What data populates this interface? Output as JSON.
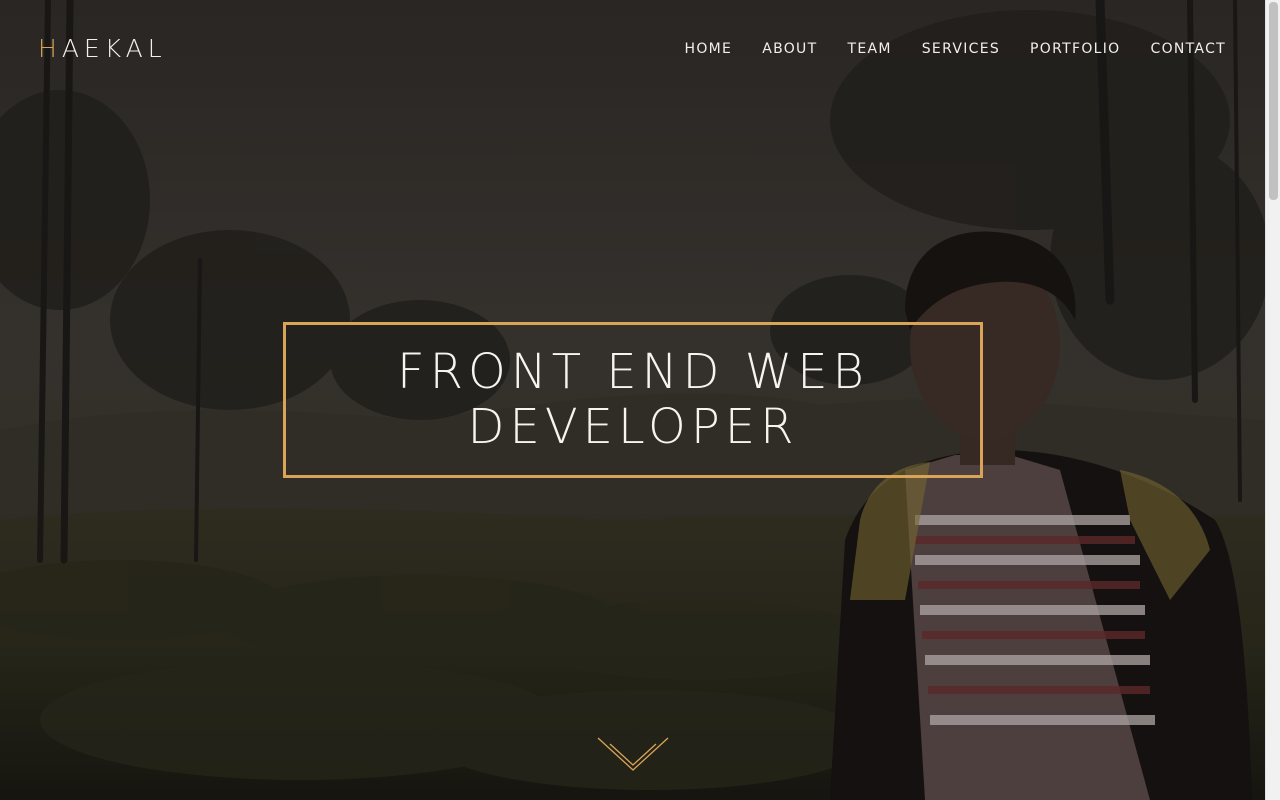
{
  "brand": {
    "accent_letter": "H",
    "rest": "AEKAL"
  },
  "nav": {
    "items": [
      {
        "label": "HOME"
      },
      {
        "label": "ABOUT"
      },
      {
        "label": "TEAM"
      },
      {
        "label": "SERVICES"
      },
      {
        "label": "PORTFOLIO"
      },
      {
        "label": "CONTACT"
      }
    ]
  },
  "hero": {
    "title_line1": "FRONT END WEB",
    "title_line2": "DEVELOPER",
    "scroll_icon": "double-chevron-down-icon",
    "background": "photo-forest-tea-plantation-person"
  },
  "colors": {
    "accent": "#d9a457",
    "text": "#f4efe8"
  }
}
